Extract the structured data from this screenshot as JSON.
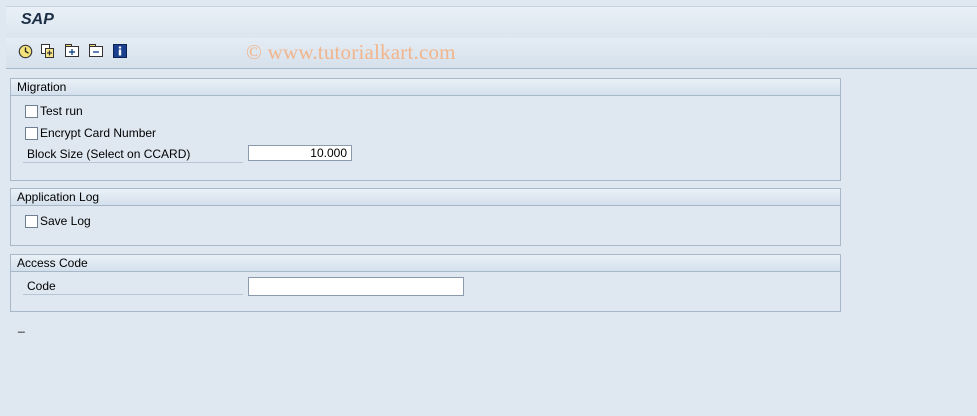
{
  "window": {
    "title": "SAP"
  },
  "toolbar": {
    "icons": [
      "execute-icon",
      "get-variant-icon",
      "expand-icon",
      "collapse-icon",
      "info-icon"
    ]
  },
  "watermark": "© www.tutorialkart.com",
  "migration": {
    "title": "Migration",
    "test_run": {
      "label": "Test run",
      "checked": false
    },
    "encrypt_card": {
      "label": "Encrypt Card Number",
      "checked": false
    },
    "block_size": {
      "label": "Block Size (Select on CCARD)",
      "value": "10.000"
    }
  },
  "app_log": {
    "title": "Application Log",
    "save_log": {
      "label": "Save Log",
      "checked": false
    }
  },
  "access_code": {
    "title": "Access Code",
    "code": {
      "label": "Code",
      "value": ""
    }
  },
  "status": {
    "marker": "_"
  },
  "colors": {
    "background": "#dfe8f1",
    "header": "#d4e0ec",
    "border": "#a7b8c9",
    "watermark": "#f2b48a"
  }
}
